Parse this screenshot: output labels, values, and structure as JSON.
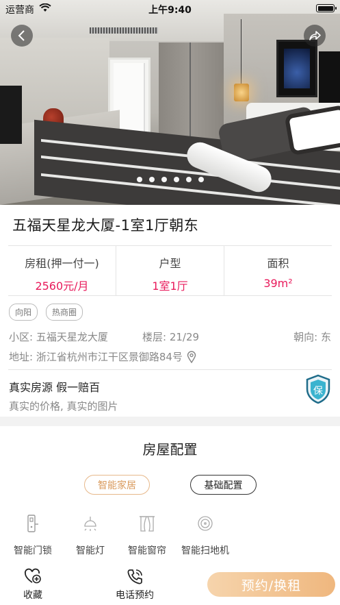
{
  "status_bar": {
    "carrier": "运营商",
    "time": "上午9:40"
  },
  "gallery": {
    "slide_count": 6
  },
  "listing": {
    "title": "五福天星龙大厦-1室1厅朝东",
    "stats": [
      {
        "label": "房租(押一付一)",
        "value": "2560元/月"
      },
      {
        "label": "户型",
        "value": "1室1厅"
      },
      {
        "label": "面积",
        "value": "39m²"
      }
    ],
    "tags": [
      "向阳",
      "热商圈"
    ],
    "community": "小区: 五福天星龙大厦",
    "floor": "楼层: 21/29",
    "orientation": "朝向: 东",
    "address": "地址: 浙江省杭州市江干区景御路84号",
    "accent_color": "#e8195a"
  },
  "guarantee": {
    "title": "真实房源  假一赔百",
    "subtitle": "真实的价格, 真实的图片",
    "badge_text": "保"
  },
  "config": {
    "title": "房屋配置",
    "tabs": [
      "智能家居",
      "基础配置"
    ],
    "devices": [
      {
        "name": "智能门锁",
        "icon": "door-lock-icon"
      },
      {
        "name": "智能灯",
        "icon": "smart-light-icon"
      },
      {
        "name": "智能窗帘",
        "icon": "curtain-icon"
      },
      {
        "name": "智能扫地机",
        "icon": "robot-vacuum-icon"
      }
    ]
  },
  "bottom_bar": {
    "favorite": "收藏",
    "phone_booking": "电话预约",
    "reserve": "预约/换租"
  }
}
